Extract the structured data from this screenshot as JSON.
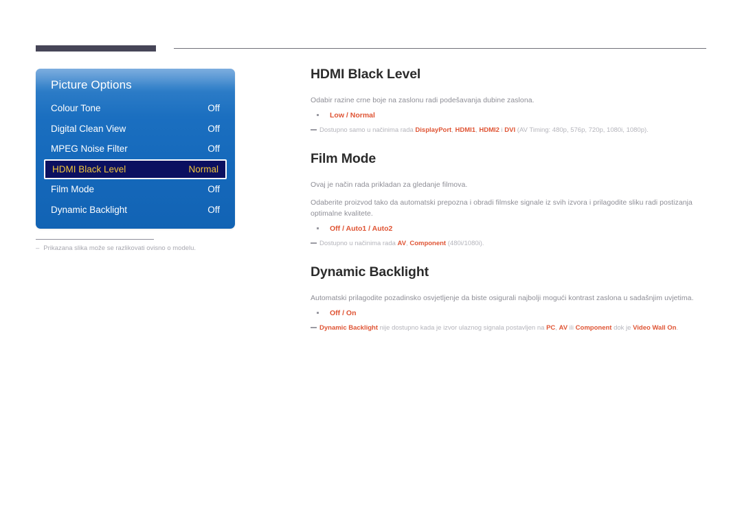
{
  "osd": {
    "title": "Picture Options",
    "rows": [
      {
        "label": "Colour Tone",
        "value": "Off",
        "selected": false
      },
      {
        "label": "Digital Clean View",
        "value": "Off",
        "selected": false
      },
      {
        "label": "MPEG Noise Filter",
        "value": "Off",
        "selected": false
      },
      {
        "label": "HDMI Black Level",
        "value": "Normal",
        "selected": true
      },
      {
        "label": "Film Mode",
        "value": "Off",
        "selected": false
      },
      {
        "label": "Dynamic Backlight",
        "value": "Off",
        "selected": false
      }
    ],
    "footnote_dash": "–",
    "footnote": "Prikazana slika može se razlikovati ovisno o modelu."
  },
  "sections": {
    "hdmi_black_level": {
      "title": "HDMI Black Level",
      "body": "Odabir razine crne boje na zaslonu radi podešavanja dubine zaslona.",
      "options": "Low / Normal",
      "note_prefix": "Dostupno samo u načinima rada ",
      "note_accent1": "DisplayPort",
      "note_sep1": ", ",
      "note_accent2": "HDMI1",
      "note_sep2": ", ",
      "note_accent3": "HDMI2",
      "note_sep3": " i ",
      "note_accent4": "DVI",
      "note_suffix": " (AV Timing: 480p, 576p, 720p, 1080i, 1080p)."
    },
    "film_mode": {
      "title": "Film Mode",
      "body1": "Ovaj je način rada prikladan za gledanje filmova.",
      "body2": "Odaberite proizvod tako da automatski prepozna i obradi filmske signale iz svih izvora i prilagodite sliku radi postizanja optimalne kvalitete.",
      "options": "Off / Auto1 / Auto2",
      "note_prefix": "Dostupno u načinima rada ",
      "note_accent1": "AV",
      "note_sep1": ", ",
      "note_accent2": "Component",
      "note_suffix": " (480i/1080i)."
    },
    "dynamic_backlight": {
      "title": "Dynamic Backlight",
      "body": "Automatski prilagodite pozadinsko osvjetljenje da biste osigurali najbolji mogući kontrast zaslona u sadašnjim uvjetima.",
      "options": "Off / On",
      "note_accent1": "Dynamic Backlight",
      "note_mid1": " nije dostupno kada je izvor ulaznog signala postavljen na ",
      "note_accent2": "PC",
      "note_sep1": ", ",
      "note_accent3": "AV",
      "note_mid2": " ili ",
      "note_accent4": "Component",
      "note_mid3": " dok je ",
      "note_accent5": "Video Wall On",
      "note_suffix": "."
    }
  },
  "colors": {
    "accent_orange": "#df5434",
    "osd_blue": "#1569bb",
    "osd_selected_bg": "#0b1060",
    "osd_selected_text": "#f0c53c",
    "rule_dark": "#464557",
    "body_gray": "#8d8d95"
  }
}
